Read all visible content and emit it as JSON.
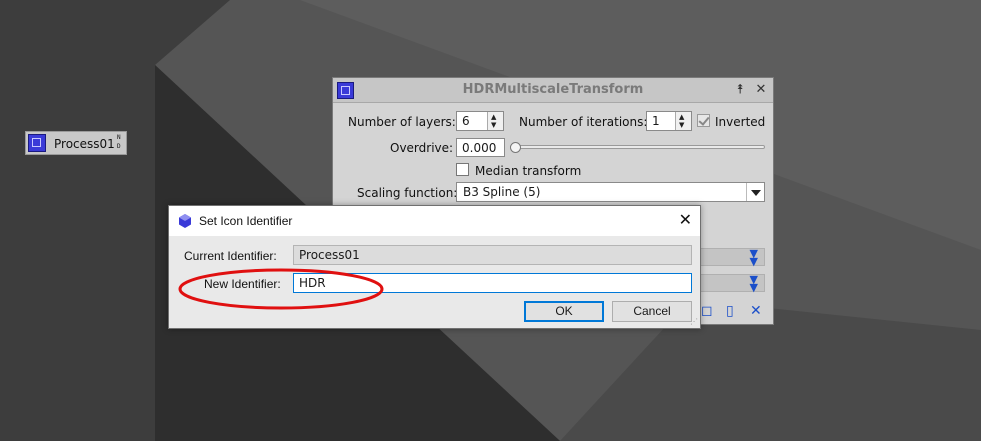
{
  "desktop_icon": {
    "label": "Process01",
    "flags": [
      "N",
      "D"
    ]
  },
  "hdr_window": {
    "title": "HDRMultiscaleTransform",
    "shade_glyph": "⯭",
    "close_glyph": "✕",
    "layers_label": "Number of layers:",
    "layers_value": "6",
    "iterations_label": "Number of iterations:",
    "iterations_value": "1",
    "inverted_label": "Inverted",
    "inverted_checked": true,
    "overdrive_label": "Overdrive:",
    "overdrive_value": "0.000",
    "overdrive_level": 0,
    "median_label": "Median transform",
    "median_checked": false,
    "scaling_label": "Scaling function:",
    "scaling_value": "B3 Spline (5)"
  },
  "dialog": {
    "title": "Set Icon Identifier",
    "current_label": "Current Identifier:",
    "current_value": "Process01",
    "new_label": "New Identifier:",
    "new_value": "HDR",
    "ok_label": "OK",
    "cancel_label": "Cancel",
    "close_glyph": "✕"
  },
  "colors": {
    "accent_blue": "#1b4fc9",
    "annotation_red": "#e01010",
    "focus_blue": "#0078d7"
  }
}
